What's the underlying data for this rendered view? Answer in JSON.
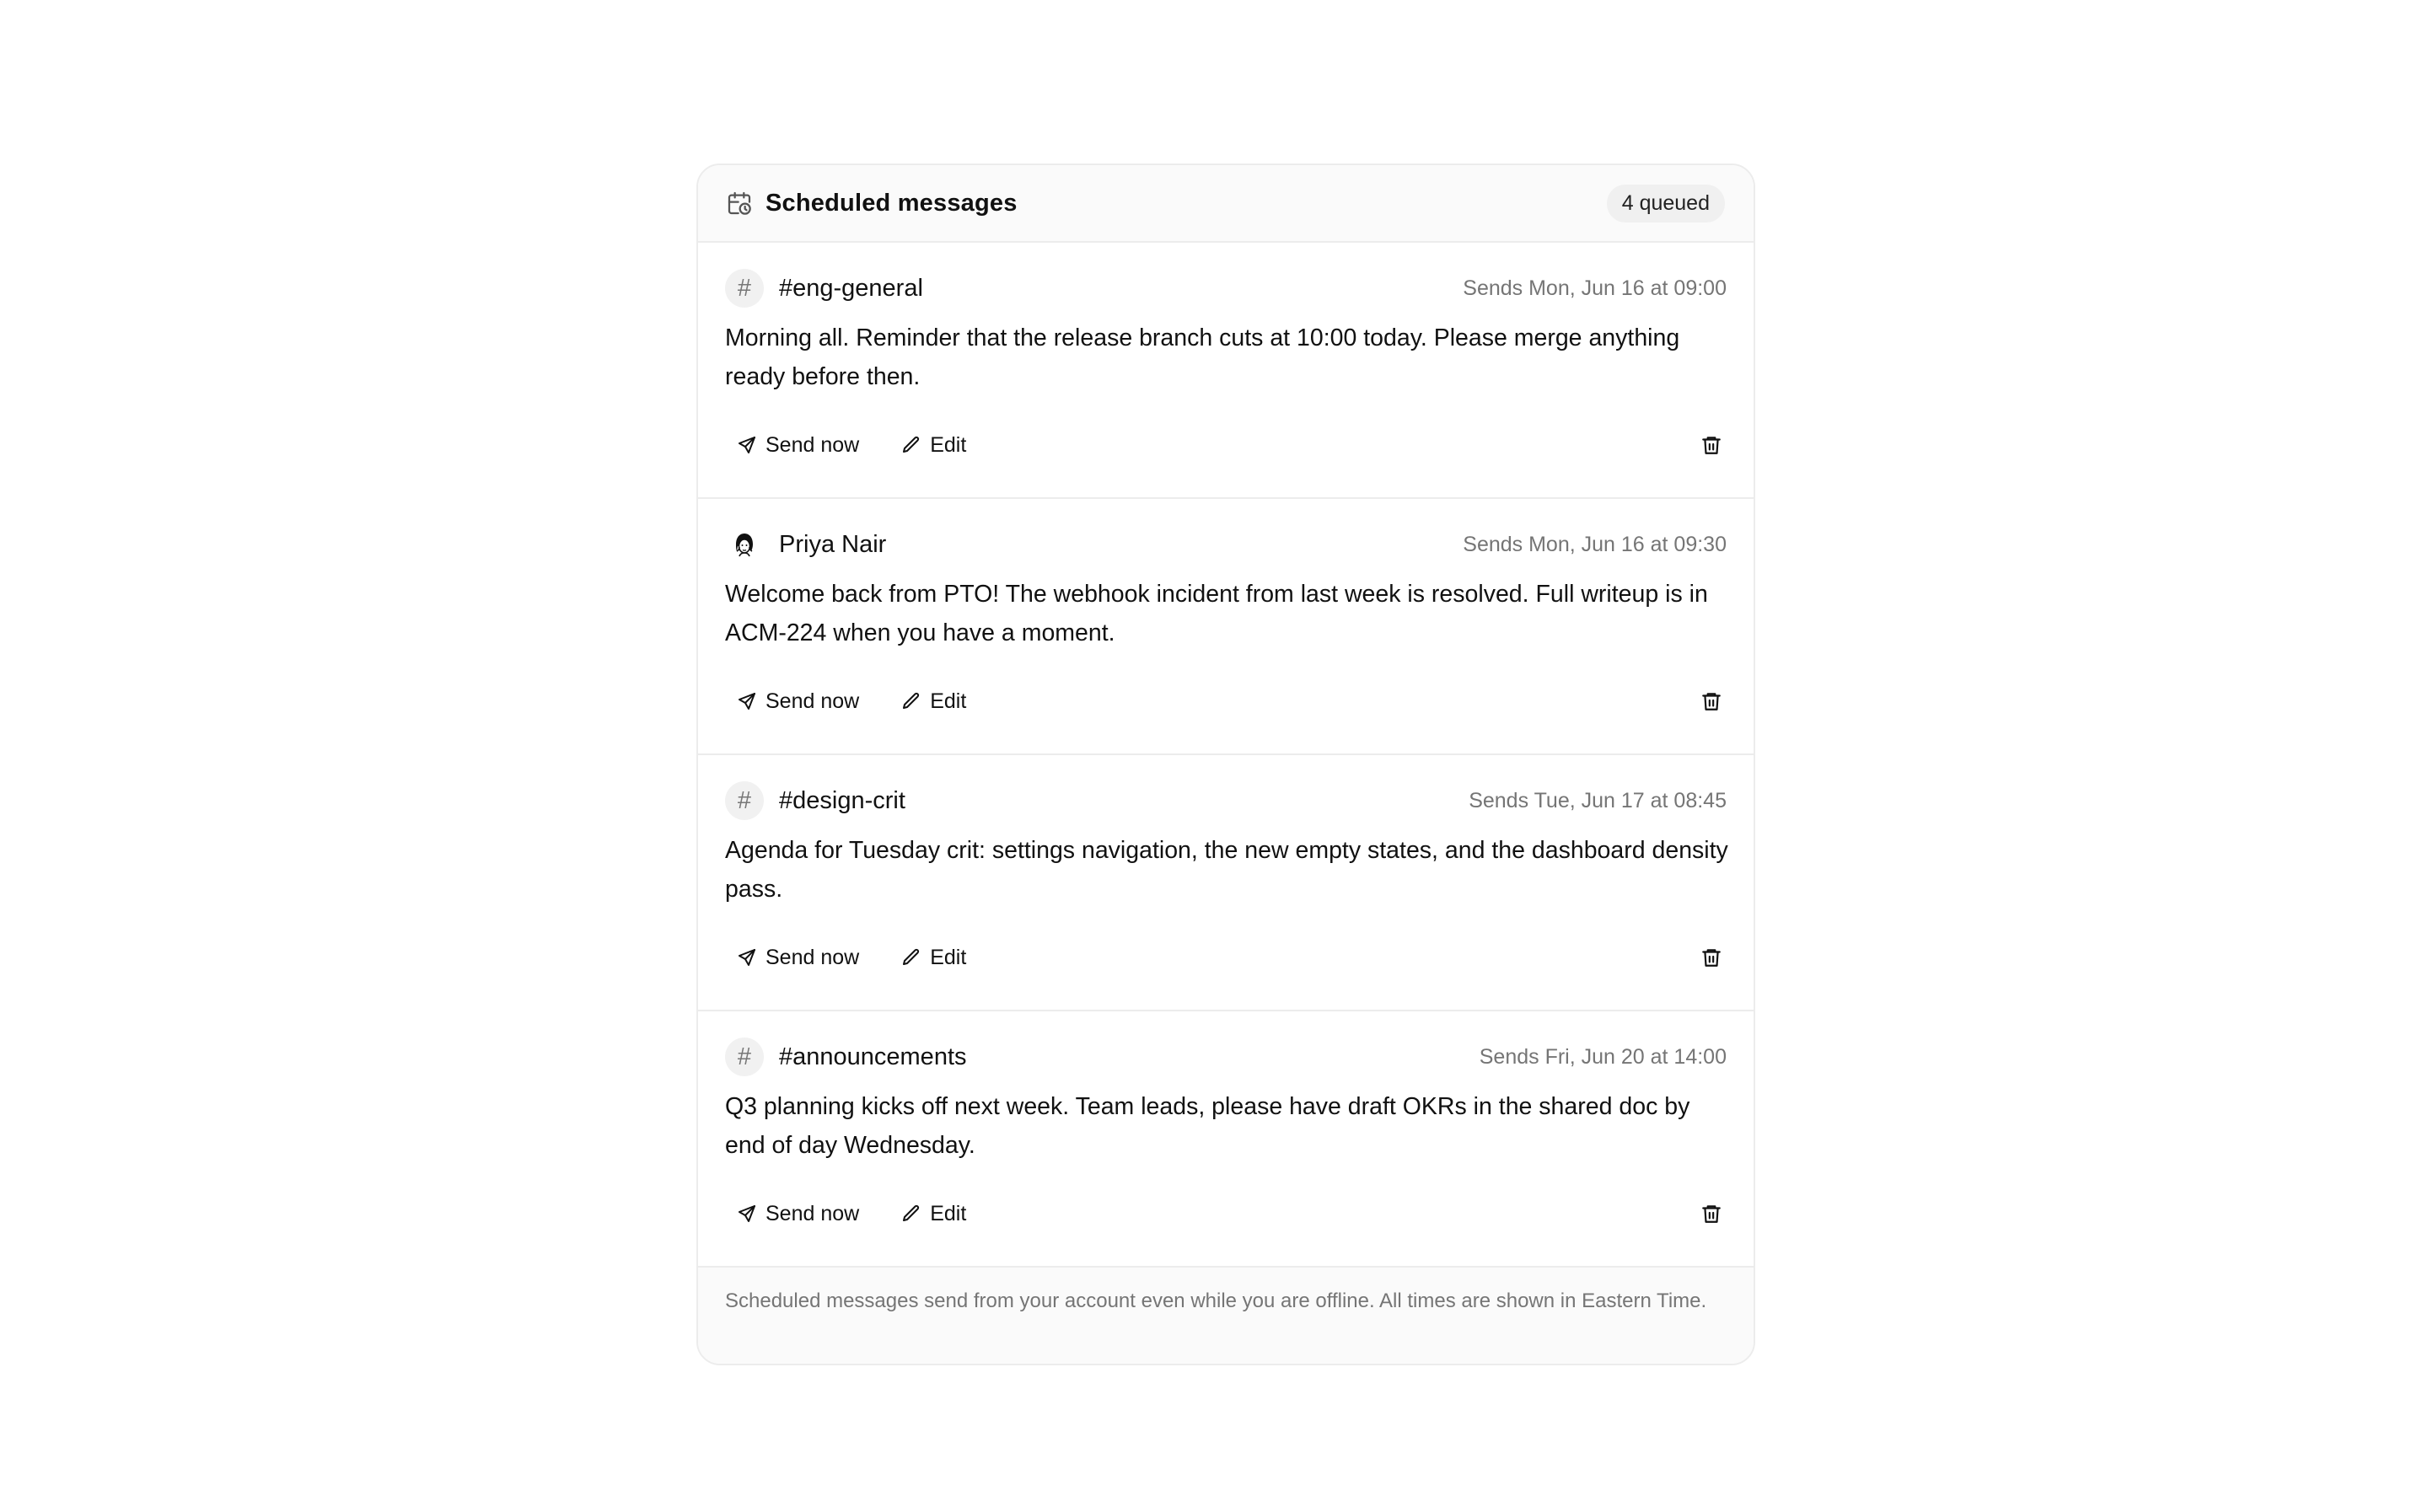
{
  "header": {
    "title": "Scheduled messages",
    "badge": "4 queued",
    "icon": "calendar-clock-icon"
  },
  "messages": [
    {
      "recipient_type": "channel",
      "recipient_glyph": "#",
      "recipient": "#eng-general",
      "send_time": "Sends Mon, Jun 16 at 09:00",
      "body": "Morning all. Reminder that the release branch cuts at 10:00 today. Please merge anything ready before then."
    },
    {
      "recipient_type": "user",
      "recipient_glyph": "",
      "recipient": "Priya Nair",
      "send_time": "Sends Mon, Jun 16 at 09:30",
      "body": "Welcome back from PTO! The webhook incident from last week is resolved. Full writeup is in ACM-224 when you have a moment."
    },
    {
      "recipient_type": "channel",
      "recipient_glyph": "#",
      "recipient": "#design-crit",
      "send_time": "Sends Tue, Jun 17 at 08:45",
      "body": "Agenda for Tuesday crit: settings navigation, the new empty states, and the dashboard density pass."
    },
    {
      "recipient_type": "channel",
      "recipient_glyph": "#",
      "recipient": "#announcements",
      "send_time": "Sends Fri, Jun 20 at 14:00",
      "body": "Q3 planning kicks off next week. Team leads, please have draft OKRs in the shared doc by end of day Wednesday."
    }
  ],
  "actions": {
    "send_now_label": "Send now",
    "edit_label": "Edit"
  },
  "footer": {
    "note": "Scheduled messages send from your account even while you are offline. All times are shown in Eastern Time."
  }
}
